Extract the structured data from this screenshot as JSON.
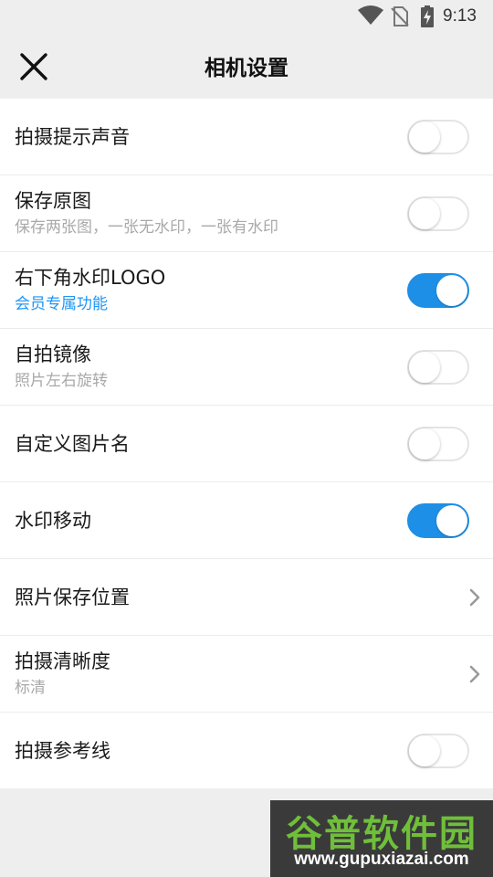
{
  "status_bar": {
    "time": "9:13",
    "icons": [
      "wifi-icon",
      "no-sim-icon",
      "battery-charging-icon"
    ]
  },
  "header": {
    "title": "相机设置",
    "close_icon": "close-icon"
  },
  "settings": [
    {
      "label": "拍摄提示声音",
      "sub": "",
      "control": "toggle",
      "on": false
    },
    {
      "label": "保存原图",
      "sub": "保存两张图，一张无水印，一张有水印",
      "control": "toggle",
      "on": false
    },
    {
      "label": "右下角水印LOGO",
      "sub": "会员专属功能",
      "control": "toggle",
      "on": true
    },
    {
      "label": "自拍镜像",
      "sub": "照片左右旋转",
      "control": "toggle",
      "on": false
    },
    {
      "label": "自定义图片名",
      "sub": "",
      "control": "toggle",
      "on": false
    },
    {
      "label": "水印移动",
      "sub": "",
      "control": "toggle",
      "on": true
    },
    {
      "label": "照片保存位置",
      "sub": "",
      "control": "chevron"
    },
    {
      "label": "拍摄清晰度",
      "sub": "标清",
      "control": "chevron"
    },
    {
      "label": "拍摄参考线",
      "sub": "",
      "control": "toggle",
      "on": false
    }
  ],
  "watermark": {
    "name": "谷普软件园",
    "url": "www.gupuxiazai.com"
  },
  "colors": {
    "accent": "#1e8fe6",
    "link": "#2196f3",
    "background": "#eeeeee",
    "watermark_green": "#6fbf3a"
  }
}
